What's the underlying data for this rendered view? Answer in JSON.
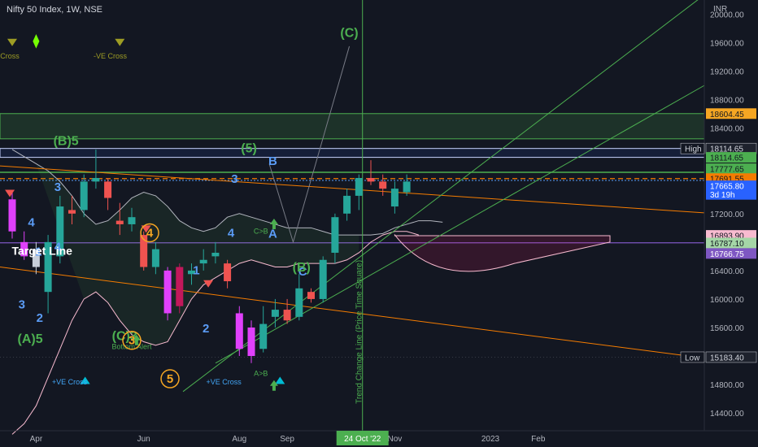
{
  "header": {
    "symbol": "Nifty 50 Index, 1W, NSE",
    "currency": "INR"
  },
  "chart_data": {
    "type": "candlestick",
    "ylim": [
      14150,
      20200
    ],
    "y_ticks": [
      14400,
      14800,
      15200,
      15600,
      16000,
      16400,
      16800,
      17200,
      17600,
      18000,
      18400,
      18800,
      19200,
      19600,
      20000
    ],
    "x_ticks": [
      {
        "label": "Apr",
        "i": 2
      },
      {
        "label": "Jun",
        "i": 11
      },
      {
        "label": "Aug",
        "i": 19
      },
      {
        "label": "Sep",
        "i": 23
      },
      {
        "label": "Nov",
        "i": 32
      },
      {
        "label": "2023",
        "i": 40
      },
      {
        "label": "Feb",
        "i": 44
      }
    ],
    "x_marker": {
      "label": "24 Oct '22",
      "i": 29.3
    },
    "candles": [
      {
        "o": 17400,
        "c": 16950,
        "h": 17500,
        "l": 16850,
        "color": "#e040fb"
      },
      {
        "o": 16800,
        "c": 16600,
        "h": 16950,
        "l": 16550,
        "color": "#e040fb"
      },
      {
        "o": 16450,
        "c": 16700,
        "h": 16800,
        "l": 16350,
        "color": "#c7ced9"
      },
      {
        "o": 16100,
        "c": 16800,
        "h": 16900,
        "l": 15800,
        "color": "#26a69a"
      },
      {
        "o": 16600,
        "c": 17300,
        "h": 17450,
        "l": 16500,
        "color": "#26a69a"
      },
      {
        "o": 17250,
        "c": 17200,
        "h": 17450,
        "l": 17050,
        "color": "#ef5350"
      },
      {
        "o": 17250,
        "c": 17650,
        "h": 17750,
        "l": 17150,
        "color": "#26a69a"
      },
      {
        "o": 17700,
        "c": 17650,
        "h": 18100,
        "l": 17550,
        "color": "#26a69a"
      },
      {
        "o": 17650,
        "c": 17420,
        "h": 17700,
        "l": 17250,
        "color": "#ef5350"
      },
      {
        "o": 17100,
        "c": 17050,
        "h": 17350,
        "l": 16900,
        "color": "#ef5350"
      },
      {
        "o": 17050,
        "c": 17150,
        "h": 17280,
        "l": 16950,
        "color": "#26a69a"
      },
      {
        "o": 16900,
        "c": 16450,
        "h": 16950,
        "l": 16400,
        "color": "#ef5350"
      },
      {
        "o": 16450,
        "c": 16700,
        "h": 16800,
        "l": 16350,
        "color": "#26a69a"
      },
      {
        "o": 16400,
        "c": 15800,
        "h": 16450,
        "l": 15700,
        "color": "#e040fb"
      },
      {
        "o": 16450,
        "c": 15900,
        "h": 16500,
        "l": 15800,
        "color": "#c2185b"
      },
      {
        "o": 16350,
        "c": 16400,
        "h": 16500,
        "l": 16200,
        "color": "#26a69a"
      },
      {
        "o": 16500,
        "c": 16550,
        "h": 16700,
        "l": 16400,
        "color": "#26a69a"
      },
      {
        "o": 16650,
        "c": 16600,
        "h": 16800,
        "l": 16500,
        "color": "#26a69a"
      },
      {
        "o": 16500,
        "c": 16250,
        "h": 16550,
        "l": 16150,
        "color": "#ef5350"
      },
      {
        "o": 15800,
        "c": 15300,
        "h": 15900,
        "l": 15200,
        "color": "#e040fb"
      },
      {
        "o": 15600,
        "c": 15200,
        "h": 15700,
        "l": 15100,
        "color": "#e040fb"
      },
      {
        "o": 15300,
        "c": 15650,
        "h": 15900,
        "l": 15250,
        "color": "#26a69a"
      },
      {
        "o": 15750,
        "c": 15850,
        "h": 16000,
        "l": 15600,
        "color": "#26a69a"
      },
      {
        "o": 15850,
        "c": 15700,
        "h": 16000,
        "l": 15650,
        "color": "#ef5350"
      },
      {
        "o": 15750,
        "c": 16150,
        "h": 16350,
        "l": 15700,
        "color": "#26a69a"
      },
      {
        "o": 16100,
        "c": 16000,
        "h": 16150,
        "l": 15950,
        "color": "#ef5350"
      },
      {
        "o": 16000,
        "c": 16550,
        "h": 16600,
        "l": 15950,
        "color": "#26a69a"
      },
      {
        "o": 16650,
        "c": 17150,
        "h": 17200,
        "l": 16500,
        "color": "#26a69a"
      },
      {
        "o": 17200,
        "c": 17450,
        "h": 17550,
        "l": 17100,
        "color": "#26a69a"
      },
      {
        "o": 17450,
        "c": 17700,
        "h": 17750,
        "l": 17250,
        "color": "#26a69a"
      },
      {
        "o": 17700,
        "c": 17650,
        "h": 17950,
        "l": 17600,
        "color": "#ef5350"
      },
      {
        "o": 17650,
        "c": 17550,
        "h": 17750,
        "l": 17450,
        "color": "#ef5350"
      },
      {
        "o": 17300,
        "c": 17550,
        "h": 17650,
        "l": 17200,
        "color": "#26a69a"
      },
      {
        "o": 17500,
        "c": 17650,
        "h": 17750,
        "l": 17450,
        "color": "#26a69a"
      }
    ],
    "price_labels": [
      {
        "text": "18604.45",
        "value": 18604.45,
        "bg": "#f5a623",
        "fg": "#131722"
      },
      {
        "text": "High",
        "value": 18114.65,
        "bg": "#131722",
        "fg": "#d1d4dc",
        "left": true
      },
      {
        "text": "18114.65",
        "value": 18114.65,
        "bg": "#1e222d",
        "fg": "#d1d4dc"
      },
      {
        "text": "18114.65",
        "value": 17990,
        "bg": "#4caf50",
        "fg": "#131722"
      },
      {
        "text": "17777.65",
        "value": 17830,
        "bg": "#4caf50",
        "fg": "#131722"
      },
      {
        "text": "17691.55",
        "value": 17691.55,
        "bg": "#f57c00",
        "fg": "#131722"
      },
      {
        "text": "17665.80",
        "value": 17590,
        "bg": "#2962ff",
        "fg": "#ffffff"
      },
      {
        "text": "3d 19h",
        "value": 17470,
        "bg": "#2962ff",
        "fg": "#ffffff"
      },
      {
        "text": "16893.90",
        "value": 16893.9,
        "bg": "#f8bbd0",
        "fg": "#131722"
      },
      {
        "text": "16787.10",
        "value": 16787.1,
        "bg": "#a5d6a7",
        "fg": "#131722"
      },
      {
        "text": "16766.75",
        "value": 16640,
        "bg": "#7e57c2",
        "fg": "#ffffff"
      },
      {
        "text": "Low",
        "value": 15183.4,
        "bg": "#131722",
        "fg": "#d1d4dc",
        "left": true
      },
      {
        "text": "15183.40",
        "value": 15183.4,
        "bg": "#1e222d",
        "fg": "#d1d4dc"
      }
    ],
    "annotations": [
      {
        "text": "(B)5",
        "i": 4.5,
        "v": 18160,
        "color": "#4caf50",
        "size": 16
      },
      {
        "text": "(5)",
        "i": 19.8,
        "v": 18060,
        "color": "#4caf50",
        "size": 16
      },
      {
        "text": "B",
        "i": 21.8,
        "v": 17880,
        "color": "#5b9cf6",
        "size": 15
      },
      {
        "text": "3",
        "i": 3.8,
        "v": 17520,
        "color": "#5b9cf6",
        "size": 15
      },
      {
        "text": "3",
        "i": 18.6,
        "v": 17630,
        "color": "#5b9cf6",
        "size": 15
      },
      {
        "text": "4",
        "i": 1.6,
        "v": 17020,
        "color": "#5b9cf6",
        "size": 15
      },
      {
        "text": "4",
        "i": 3.8,
        "v": 16680,
        "color": "#5b9cf6",
        "size": 15
      },
      {
        "text": "4",
        "i": 18.3,
        "v": 16870,
        "color": "#5b9cf6",
        "size": 15
      },
      {
        "text": "1",
        "i": 15.4,
        "v": 16350,
        "color": "#5b9cf6",
        "size": 15
      },
      {
        "text": "1",
        "i": 2.2,
        "v": 16610,
        "color": "#5b9cf6",
        "size": 15
      },
      {
        "text": "3",
        "i": 0.8,
        "v": 15870,
        "color": "#5b9cf6",
        "size": 15
      },
      {
        "text": "2",
        "i": 2.3,
        "v": 15680,
        "color": "#5b9cf6",
        "size": 15
      },
      {
        "text": "2",
        "i": 16.2,
        "v": 15530,
        "color": "#5b9cf6",
        "size": 15
      },
      {
        "text": "A",
        "i": 21.8,
        "v": 16860,
        "color": "#5b9cf6",
        "size": 15
      },
      {
        "text": "C",
        "i": 24.3,
        "v": 16330,
        "color": "#5b9cf6",
        "size": 15
      },
      {
        "text": "(B)",
        "i": 24.2,
        "v": 16390,
        "color": "#4caf50",
        "size": 16
      },
      {
        "text": "(C)",
        "i": 28.2,
        "v": 19680,
        "color": "#4caf50",
        "size": 16
      },
      {
        "text": "(A)5",
        "i": 1.5,
        "v": 15380,
        "color": "#4caf50",
        "size": 16
      },
      {
        "text": "(C)3",
        "i": 9.4,
        "v": 15420,
        "color": "#4caf50",
        "size": 16
      },
      {
        "text": "Target Line",
        "i": 2.5,
        "v": 16620,
        "color": "#ffffff",
        "size": 14
      },
      {
        "text": "Bottom Alert",
        "i": 10.0,
        "v": 15300,
        "color": "#4caf50",
        "size": 9
      },
      {
        "text": "C>B",
        "i": 20.8,
        "v": 16920,
        "color": "#4caf50",
        "size": 9
      },
      {
        "text": "A>B",
        "i": 20.8,
        "v": 14920,
        "color": "#4caf50",
        "size": 9
      },
      {
        "text": "+VE Cross",
        "i": 4.8,
        "v": 14800,
        "color": "#42a5f5",
        "size": 9
      },
      {
        "text": "+VE Cross",
        "i": 17.7,
        "v": 14800,
        "color": "#42a5f5",
        "size": 9
      },
      {
        "text": "-VE Cross",
        "i": 8.2,
        "v": 19380,
        "color": "#9e9d24",
        "size": 9
      },
      {
        "text": "Cross",
        "i": -0.2,
        "v": 19380,
        "color": "#9e9d24",
        "size": 9
      }
    ],
    "circled": [
      {
        "text": "4",
        "i": 11.5,
        "v": 16930,
        "color": "#f5a623"
      },
      {
        "text": "5",
        "i": 13.2,
        "v": 14880,
        "color": "#f5a623"
      },
      {
        "text": "3",
        "i": 10.0,
        "v": 15420,
        "color": "#f5a623"
      }
    ],
    "vertical_label": {
      "text": "Trend Change Line (Price Time Square)",
      "i": 28.6,
      "v": 14300
    }
  }
}
